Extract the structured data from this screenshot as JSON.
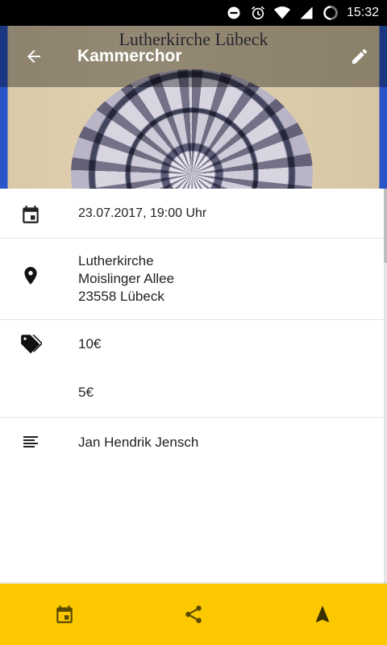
{
  "status_bar": {
    "time": "15:32"
  },
  "header": {
    "poster_title": "Lutherkirche Lübeck",
    "title": "Kammerchor"
  },
  "details": {
    "date": "23.07.2017, 19:00 Uhr",
    "location": {
      "line1": "Lutherkirche",
      "line2": "Moislinger Allee",
      "line3": "23558 Lübeck"
    },
    "prices": [
      "10€",
      "5€"
    ],
    "person": "Jan Hendrik Jensch"
  },
  "colors": {
    "accent": "#fcc800",
    "icon": "#222222"
  },
  "bottom_bar": {
    "icons": [
      "calendar-icon",
      "share-icon",
      "navigation-icon"
    ]
  }
}
